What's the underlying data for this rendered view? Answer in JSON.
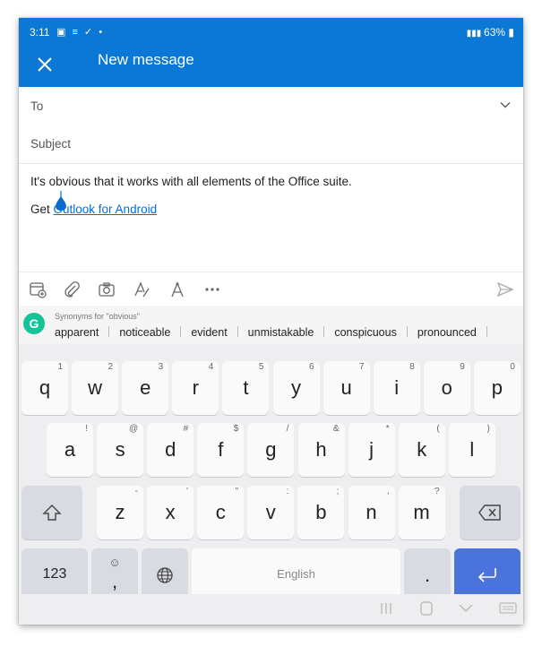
{
  "status": {
    "time": "3:11",
    "icons": "▣ ≡ ✓ •",
    "battery": "63%"
  },
  "appbar": {
    "title": "New message"
  },
  "to": {
    "label": "To"
  },
  "subject": {
    "label": "Subject"
  },
  "body": {
    "text": "It's obvious that it works with all elements of the Office suite.",
    "signature_prefix": "Get ",
    "signature_link": "Outlook for Android"
  },
  "suggestions": {
    "title": "Synonyms for \"obvious\"",
    "items": [
      "apparent",
      "noticeable",
      "evident",
      "unmistakable",
      "conspicuous",
      "pronounced"
    ]
  },
  "keyboard": {
    "row1": [
      {
        "k": "q",
        "h": "1"
      },
      {
        "k": "w",
        "h": "2"
      },
      {
        "k": "e",
        "h": "3"
      },
      {
        "k": "r",
        "h": "4"
      },
      {
        "k": "t",
        "h": "5"
      },
      {
        "k": "y",
        "h": "6"
      },
      {
        "k": "u",
        "h": "7"
      },
      {
        "k": "i",
        "h": "8"
      },
      {
        "k": "o",
        "h": "9"
      },
      {
        "k": "p",
        "h": "0"
      }
    ],
    "row2": [
      {
        "k": "a",
        "h": "!"
      },
      {
        "k": "s",
        "h": "@"
      },
      {
        "k": "d",
        "h": "#"
      },
      {
        "k": "f",
        "h": "$"
      },
      {
        "k": "g",
        "h": "/"
      },
      {
        "k": "h",
        "h": "&"
      },
      {
        "k": "j",
        "h": "*"
      },
      {
        "k": "k",
        "h": "("
      },
      {
        "k": "l",
        "h": ")"
      }
    ],
    "row3": [
      {
        "k": "z",
        "h": "-"
      },
      {
        "k": "x",
        "h": "'"
      },
      {
        "k": "c",
        "h": "\""
      },
      {
        "k": "v",
        "h": ":"
      },
      {
        "k": "b",
        "h": ";"
      },
      {
        "k": "n",
        "h": ","
      },
      {
        "k": "m",
        "h": "?"
      }
    ],
    "num_label": "123",
    "comma_label": ",",
    "space_label": "English",
    "period_label": "."
  },
  "colors": {
    "accent": "#0a78d4",
    "enter": "#4a73dc",
    "grammarly": "#15c39a"
  }
}
